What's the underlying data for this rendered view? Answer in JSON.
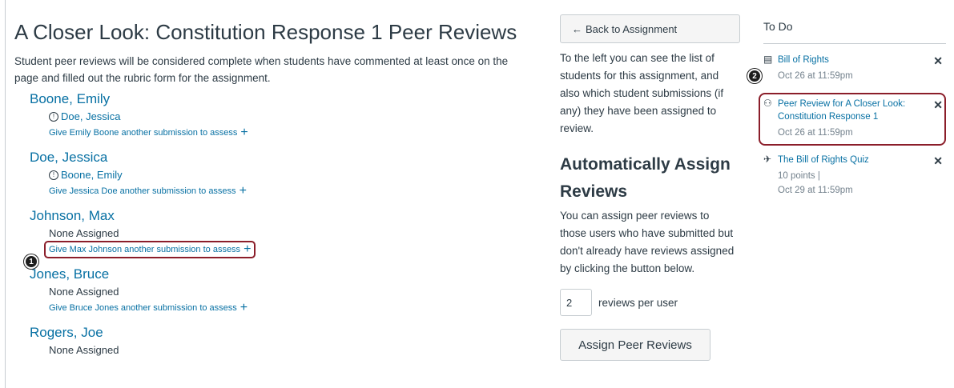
{
  "page": {
    "title": "A Closer Look: Constitution Response 1 Peer Reviews",
    "intro": "Student peer reviews will be considered complete when students have commented at least once on the page and filled out the rubric form for the assignment."
  },
  "students": [
    {
      "name": "Boone, Emily",
      "assigned": "Doe, Jessica",
      "give": "Give Emily Boone another submission to assess"
    },
    {
      "name": "Doe, Jessica",
      "assigned": "Boone, Emily",
      "give": "Give Jessica Doe another submission to assess"
    },
    {
      "name": "Johnson, Max",
      "none": "None Assigned",
      "give": "Give Max Johnson another submission to assess"
    },
    {
      "name": "Jones, Bruce",
      "none": "None Assigned",
      "give": "Give Bruce Jones another submission to assess"
    },
    {
      "name": "Rogers, Joe",
      "none": "None Assigned"
    }
  ],
  "callouts": [
    "1",
    "2"
  ],
  "sidebar": {
    "back_label": "Back to Assignment",
    "help_text": "To the left you can see the list of students for this assignment, and also which student submissions (if any) they have been assigned to review.",
    "auto_title": "Automatically Assign Reviews",
    "auto_text": "You can assign peer reviews to those users who have submitted but don't already have reviews assigned by clicking the button below.",
    "reviews_count": "2",
    "reviews_label": "reviews per user",
    "assign_button": "Assign Peer Reviews"
  },
  "todo": {
    "title": "To Do",
    "items": [
      {
        "title": "Bill of Rights",
        "meta": "Oct 26 at 11:59pm",
        "icon": "document-icon"
      },
      {
        "title": "Peer Review for A Closer Look: Constitution Response 1",
        "meta": "Oct 26 at 11:59pm",
        "icon": "peer-review-icon"
      },
      {
        "title": "The Bill of Rights Quiz",
        "meta_points": "10 points  |",
        "meta": "Oct 29 at 11:59pm",
        "icon": "quiz-icon"
      }
    ]
  },
  "colors": {
    "link": "#0770a3",
    "text": "#2d3b45",
    "highlight": "#8b1e2a"
  }
}
